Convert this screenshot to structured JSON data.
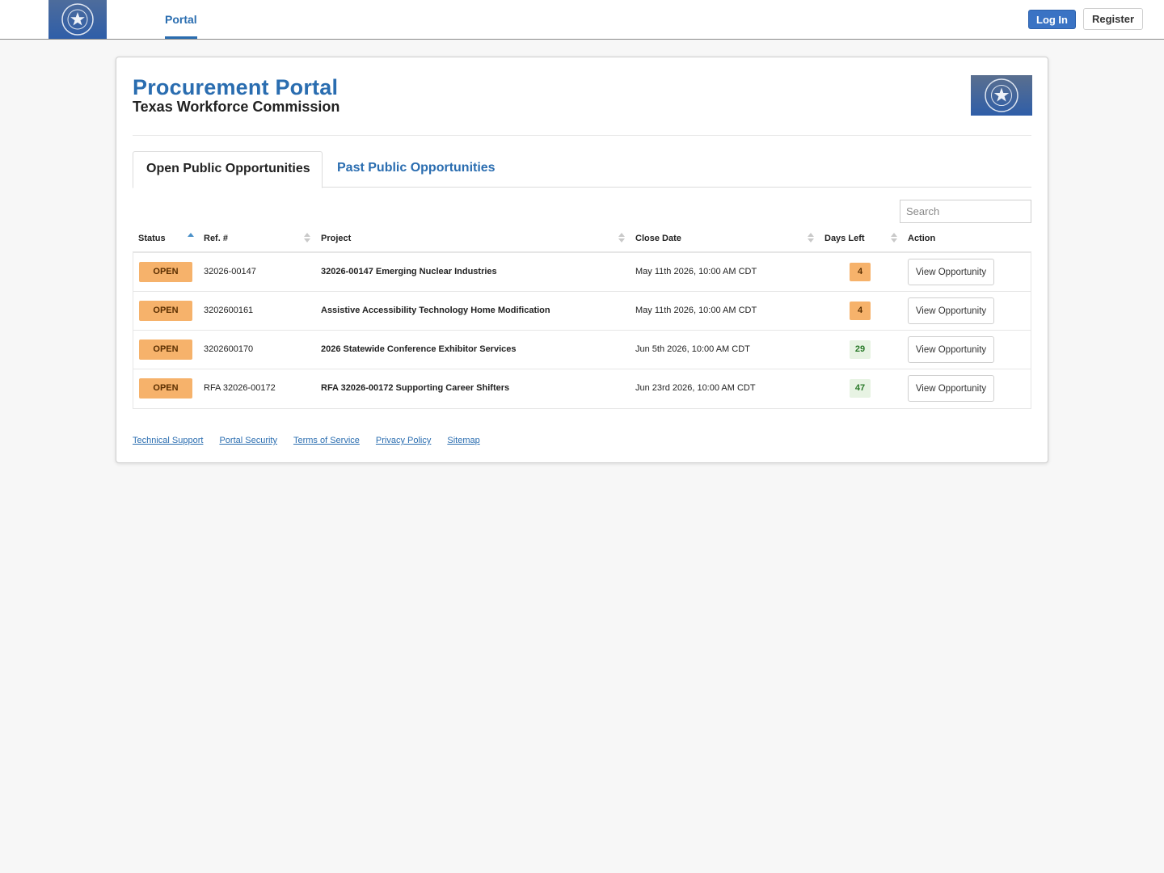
{
  "nav": {
    "portal_label": "Portal",
    "login_label": "Log In",
    "register_label": "Register"
  },
  "header": {
    "title": "Procurement Portal",
    "subtitle": "Texas Workforce Commission"
  },
  "tabs": [
    {
      "label": "Open Public Opportunities",
      "active": true
    },
    {
      "label": "Past Public Opportunities",
      "active": false
    }
  ],
  "search": {
    "placeholder": "Search",
    "value": ""
  },
  "table": {
    "columns": [
      "Status",
      "Ref. #",
      "Project",
      "Close Date",
      "Days Left",
      "Action"
    ],
    "rows": [
      {
        "status": "OPEN",
        "ref": "32026-00147",
        "project": "32026-00147 Emerging Nuclear Industries",
        "close_date": "May 11th 2026, 10:00 AM CDT",
        "days_left": "4",
        "action": "View Opportunity"
      },
      {
        "status": "OPEN",
        "ref": "3202600161",
        "project": "Assistive Accessibility Technology Home Modification",
        "close_date": "May 11th 2026, 10:00 AM CDT",
        "days_left": "4",
        "action": "View Opportunity"
      },
      {
        "status": "OPEN",
        "ref": "3202600170",
        "project": "2026 Statewide Conference Exhibitor Services",
        "close_date": "Jun 5th 2026, 10:00 AM CDT",
        "days_left": "29",
        "action": "View Opportunity"
      },
      {
        "status": "OPEN",
        "ref": "RFA 32026-00172",
        "project": "RFA 32026-00172 Supporting Career Shifters",
        "close_date": "Jun 23rd 2026, 10:00 AM CDT",
        "days_left": "47",
        "action": "View Opportunity"
      }
    ]
  },
  "footer": {
    "links": [
      "Technical Support",
      "Portal Security",
      "Terms of Service",
      "Privacy Policy",
      "Sitemap"
    ]
  },
  "colors": {
    "brand_blue": "#2a6db0",
    "open_badge": "#f6b26b",
    "days_ok": "#e7f3e3"
  }
}
